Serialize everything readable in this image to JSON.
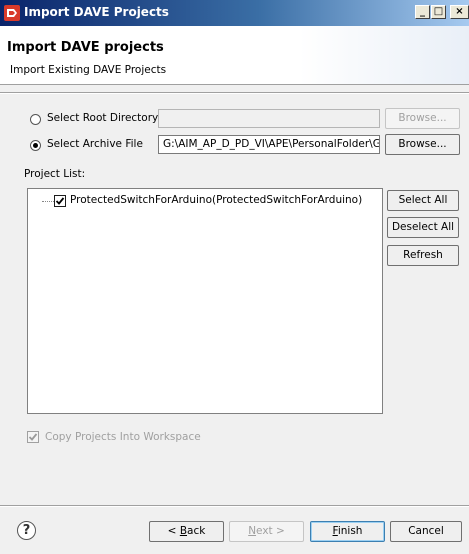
{
  "window": {
    "title": "Import DAVE Projects",
    "min_glyph": "_",
    "max_glyph": "□",
    "close_glyph": "×"
  },
  "header": {
    "title": "Import DAVE projects",
    "subtitle": "Import Existing DAVE Projects"
  },
  "source": {
    "root_dir": {
      "label": "Select Root Directory",
      "selected": false,
      "value": "",
      "browse_label": "Browse..."
    },
    "archive": {
      "label": "Select Archive File",
      "selected": true,
      "value": "G:\\AIM_AP_D_PD_VI\\APE\\PersonalFolder\\Gie",
      "browse_label": "Browse..."
    }
  },
  "project_list": {
    "label": "Project List:",
    "items": [
      {
        "label": "ProtectedSwitchForArduino(ProtectedSwitchForArduino)",
        "checked": true
      }
    ]
  },
  "side_buttons": {
    "select_all": "Select All",
    "deselect_all": "Deselect All",
    "refresh": "Refresh"
  },
  "copy_into_workspace": {
    "label": "Copy Projects Into Workspace",
    "checked": true,
    "enabled": false
  },
  "footer": {
    "help_glyph": "?",
    "back_pre": "< ",
    "back_mn": "B",
    "back_post": "ack",
    "next_pre": "",
    "next_mn": "N",
    "next_post": "ext >",
    "finish_mn": "F",
    "finish_post": "inish",
    "cancel": "Cancel"
  },
  "colors": {
    "titlebar_start": "#0a246a",
    "titlebar_end": "#a6caf0",
    "dialog_bg": "#f0f0f0",
    "default_button_border": "#3c7fb1"
  }
}
